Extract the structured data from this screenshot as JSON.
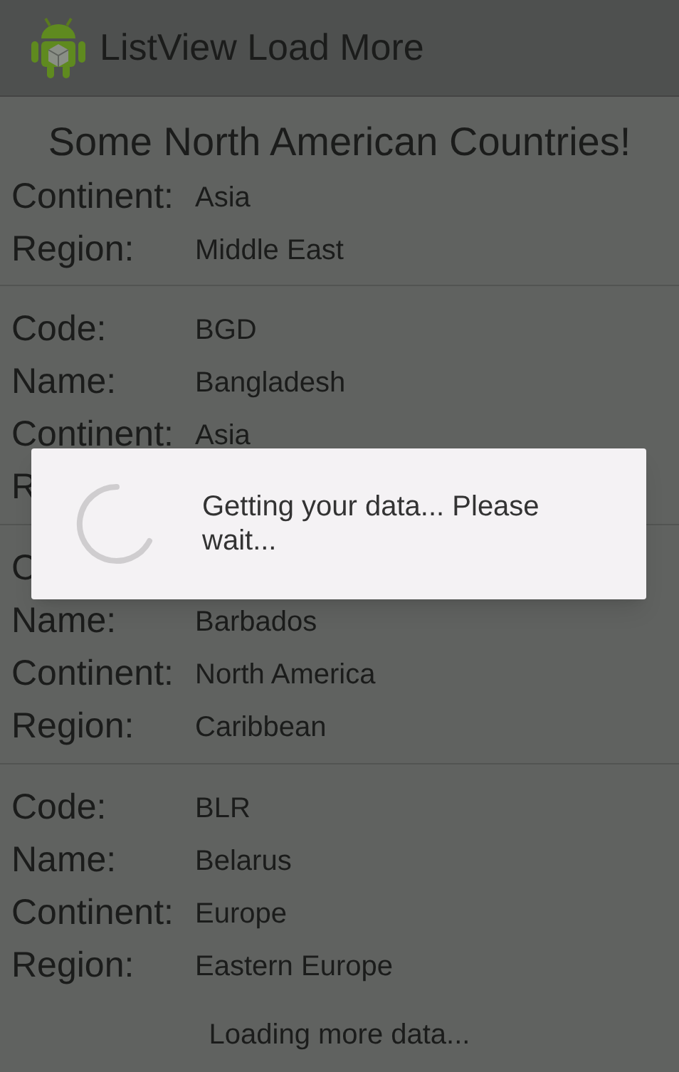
{
  "action_bar": {
    "title": "ListView Load More"
  },
  "header": "Some North American Countries!",
  "countries": [
    {
      "fields": [
        {
          "label": "Continent:",
          "value": "Asia"
        },
        {
          "label": "Region:",
          "value": "Middle East"
        }
      ]
    },
    {
      "fields": [
        {
          "label": "Code:",
          "value": "BGD"
        },
        {
          "label": "Name:",
          "value": "Bangladesh"
        },
        {
          "label": "Continent:",
          "value": "Asia"
        },
        {
          "label": "R"
        }
      ]
    },
    {
      "fields": [
        {
          "label": "C"
        },
        {
          "label": "Name:",
          "value": "Barbados"
        },
        {
          "label": "Continent:",
          "value": "North America"
        },
        {
          "label": "Region:",
          "value": "Caribbean"
        }
      ]
    },
    {
      "fields": [
        {
          "label": "Code:",
          "value": "BLR"
        },
        {
          "label": "Name:",
          "value": "Belarus"
        },
        {
          "label": "Continent:",
          "value": "Europe"
        },
        {
          "label": "Region:",
          "value": "Eastern Europe"
        }
      ]
    }
  ],
  "footer": "Loading more data...",
  "dialog": {
    "message": "Getting your data... Please wait..."
  }
}
